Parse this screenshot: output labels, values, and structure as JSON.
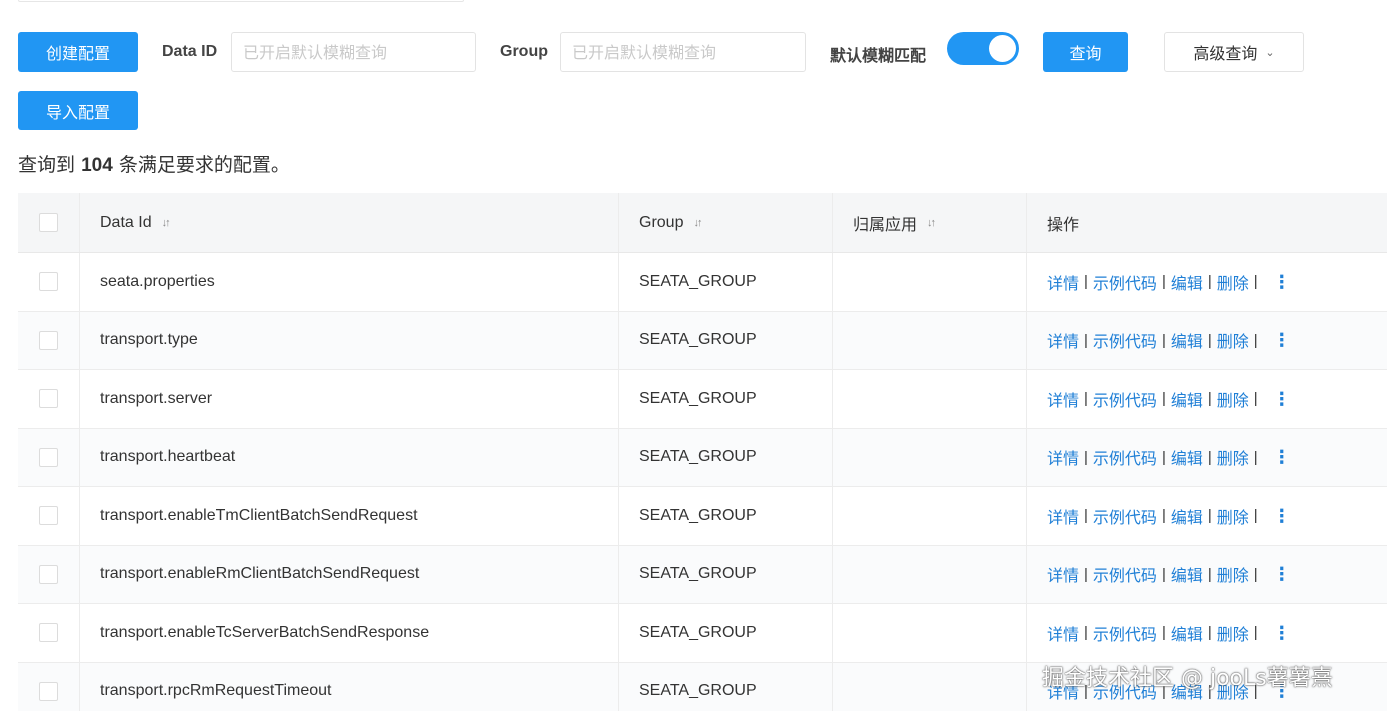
{
  "toolbar": {
    "create_label": "创建配置",
    "import_label": "导入配置",
    "data_id_label": "Data ID",
    "data_id_placeholder": "已开启默认模糊查询",
    "group_label": "Group",
    "group_placeholder": "已开启默认模糊查询",
    "fuzzy_label": "默认模糊匹配",
    "fuzzy_on": true,
    "search_label": "查询",
    "advanced_label": "高级查询"
  },
  "summary": {
    "prefix": "查询到",
    "count": "104",
    "suffix": "条满足要求的配置。"
  },
  "table": {
    "headers": {
      "data_id": "Data Id",
      "group": "Group",
      "app": "归属应用",
      "ops": "操作"
    },
    "ops": {
      "detail": "详情",
      "sample": "示例代码",
      "edit": "编辑",
      "delete": "删除",
      "sep": "|"
    },
    "rows": [
      {
        "data_id": "seata.properties",
        "group": "SEATA_GROUP",
        "app": ""
      },
      {
        "data_id": "transport.type",
        "group": "SEATA_GROUP",
        "app": ""
      },
      {
        "data_id": "transport.server",
        "group": "SEATA_GROUP",
        "app": ""
      },
      {
        "data_id": "transport.heartbeat",
        "group": "SEATA_GROUP",
        "app": ""
      },
      {
        "data_id": "transport.enableTmClientBatchSendRequest",
        "group": "SEATA_GROUP",
        "app": ""
      },
      {
        "data_id": "transport.enableRmClientBatchSendRequest",
        "group": "SEATA_GROUP",
        "app": ""
      },
      {
        "data_id": "transport.enableTcServerBatchSendResponse",
        "group": "SEATA_GROUP",
        "app": ""
      },
      {
        "data_id": "transport.rpcRmRequestTimeout",
        "group": "SEATA_GROUP",
        "app": ""
      }
    ]
  },
  "watermark": "掘金技术社区 @ jooLs薯薯熹",
  "icons": {
    "sort": "sort-icon",
    "chevron": "chevron-down-icon",
    "more": "more-vertical-icon"
  },
  "colors": {
    "primary": "#2196f3",
    "link": "#1f7fd6"
  }
}
